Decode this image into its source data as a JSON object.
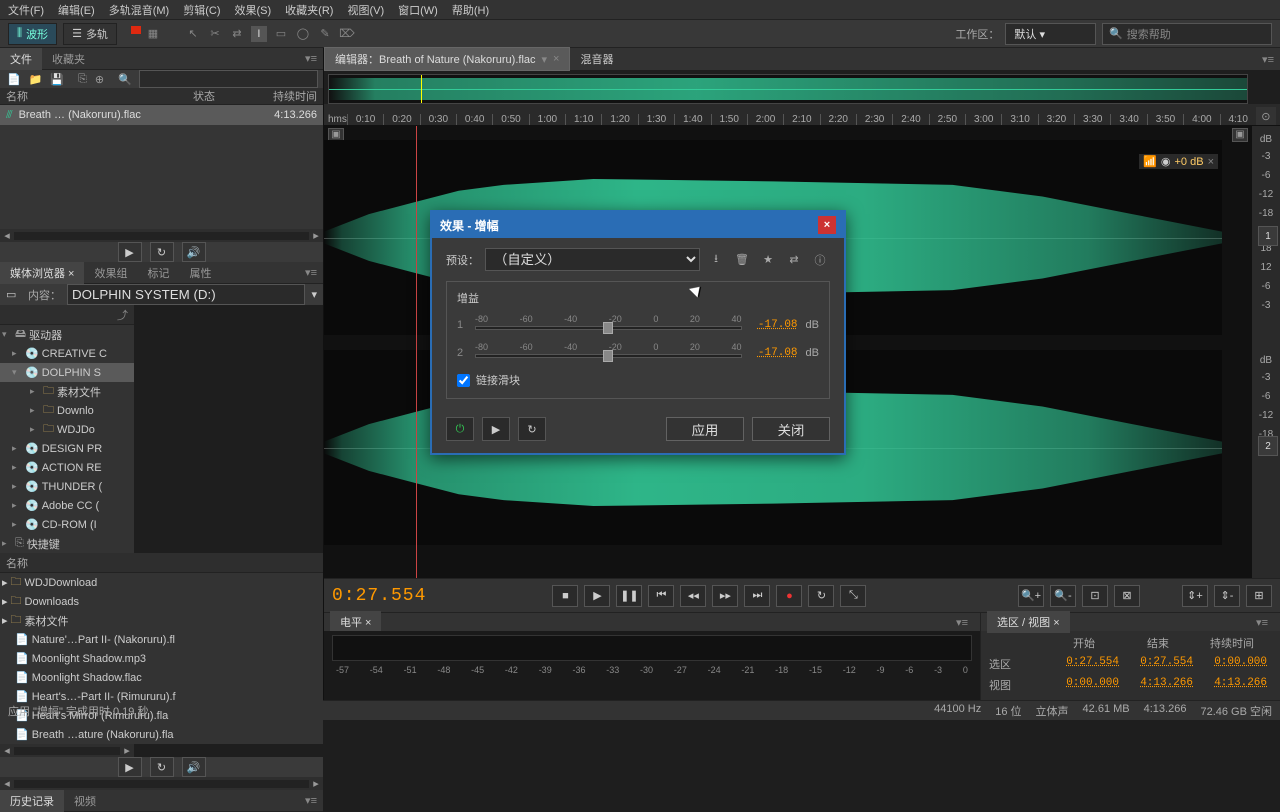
{
  "menu": [
    "文件(F)",
    "编辑(E)",
    "多轨混音(M)",
    "剪辑(C)",
    "效果(S)",
    "收藏夹(R)",
    "视图(V)",
    "窗口(W)",
    "帮助(H)"
  ],
  "toolbar": {
    "waveform": "波形",
    "multitrack": "多轨",
    "workspace_label": "工作区：",
    "workspace": "默认",
    "search_placeholder": "搜索帮助"
  },
  "files_panel": {
    "tabs": [
      "文件",
      "收藏夹"
    ],
    "cols": {
      "name": "名称",
      "status": "状态",
      "duration": "持续时间"
    },
    "rows": [
      {
        "name": "Breath … (Nakoruru).flac",
        "duration": "4:13.266"
      }
    ]
  },
  "media_tabs": [
    "媒体浏览器",
    "效果组",
    "标记",
    "属性"
  ],
  "media_content": {
    "label": "内容：",
    "value": "DOLPHIN SYSTEM (D:)"
  },
  "drives_header": "驱动器",
  "drives": [
    {
      "exp": "▾",
      "name": "CREATIVE C"
    },
    {
      "exp": "▾",
      "name": "DOLPHIN S",
      "sel": true,
      "children": [
        {
          "name": "素材文件"
        },
        {
          "name": "Downlo"
        },
        {
          "name": "WDJDo"
        }
      ]
    },
    {
      "exp": "▸",
      "name": "DESIGN PR"
    },
    {
      "exp": "▸",
      "name": "ACTION RE"
    },
    {
      "exp": "▸",
      "name": "THUNDER ("
    },
    {
      "exp": "▸",
      "name": "Adobe CC ("
    },
    {
      "exp": "▸",
      "name": "CD-ROM (I"
    }
  ],
  "shortcut": "快捷键",
  "filetree_header": "名称",
  "files": [
    {
      "t": "d",
      "name": "WDJDownload"
    },
    {
      "t": "d",
      "name": "Downloads"
    },
    {
      "t": "d",
      "name": "素材文件"
    },
    {
      "t": "f",
      "name": "Nature'…Part II- (Nakoruru).fl"
    },
    {
      "t": "f",
      "name": "Moonlight Shadow.mp3"
    },
    {
      "t": "f",
      "name": "Moonlight Shadow.flac"
    },
    {
      "t": "f",
      "name": "Heart's…-Part II- (Rimururu).f"
    },
    {
      "t": "f",
      "name": "Heart's Mirror (Rimururu).fla"
    },
    {
      "t": "f",
      "name": "Breath …ature (Nakoruru).fla"
    }
  ],
  "history_tabs": [
    "历史记录",
    "视频"
  ],
  "editor": {
    "tab": "编辑器：Breath of Nature (Nakoruru).flac",
    "tab2": "混音器"
  },
  "timeline": {
    "hms": "hms",
    "ticks": [
      "0:10",
      "0:20",
      "0:30",
      "0:40",
      "0:50",
      "1:00",
      "1:10",
      "1:20",
      "1:30",
      "1:40",
      "1:50",
      "2:00",
      "2:10",
      "2:20",
      "2:30",
      "2:40",
      "2:50",
      "3:00",
      "3:10",
      "3:20",
      "3:30",
      "3:40",
      "3:50",
      "4:00",
      "4:10"
    ]
  },
  "db_unit": "dB",
  "db_marks": [
    "-3",
    "-6",
    "-12",
    "-18",
    "18",
    "12",
    "-6",
    "-3"
  ],
  "gain_badge": "+0 dB",
  "timecode": "0:27.554",
  "levels": {
    "tab": "电平",
    "ticks": [
      "-57",
      "-54",
      "-51",
      "-48",
      "-45",
      "-42",
      "-39",
      "-36",
      "-33",
      "-30",
      "-27",
      "-24",
      "-21",
      "-18",
      "-15",
      "-12",
      "-9",
      "-6",
      "-3",
      "0"
    ]
  },
  "selection": {
    "title": "选区 / 视图",
    "cols": [
      "开始",
      "结束",
      "持续时间"
    ],
    "rows": [
      {
        "lbl": "选区",
        "v": [
          "0:27.554",
          "0:27.554",
          "0:00.000"
        ]
      },
      {
        "lbl": "视图",
        "v": [
          "0:00.000",
          "4:13.266",
          "4:13.266"
        ]
      }
    ]
  },
  "status": {
    "msg": "应用 \"增幅\" 完成用时 0.19 秒",
    "sr": "44100 Hz",
    "bit": "16 位",
    "ch": "立体声",
    "size": "42.61 MB",
    "dur": "4:13.266",
    "disk": "72.46 GB 空闲"
  },
  "dialog": {
    "title": "效果 - 增幅",
    "preset_label": "预设：",
    "preset": "（自定义）",
    "gain_title": "增益",
    "ch1": "1",
    "ch2": "2",
    "ticks": [
      "-80",
      "-60",
      "-40",
      "-20",
      "0",
      "20",
      "40"
    ],
    "value": "-17.08",
    "unit": "dB",
    "link": "链接滑块",
    "apply": "应用",
    "close": "关闭"
  }
}
